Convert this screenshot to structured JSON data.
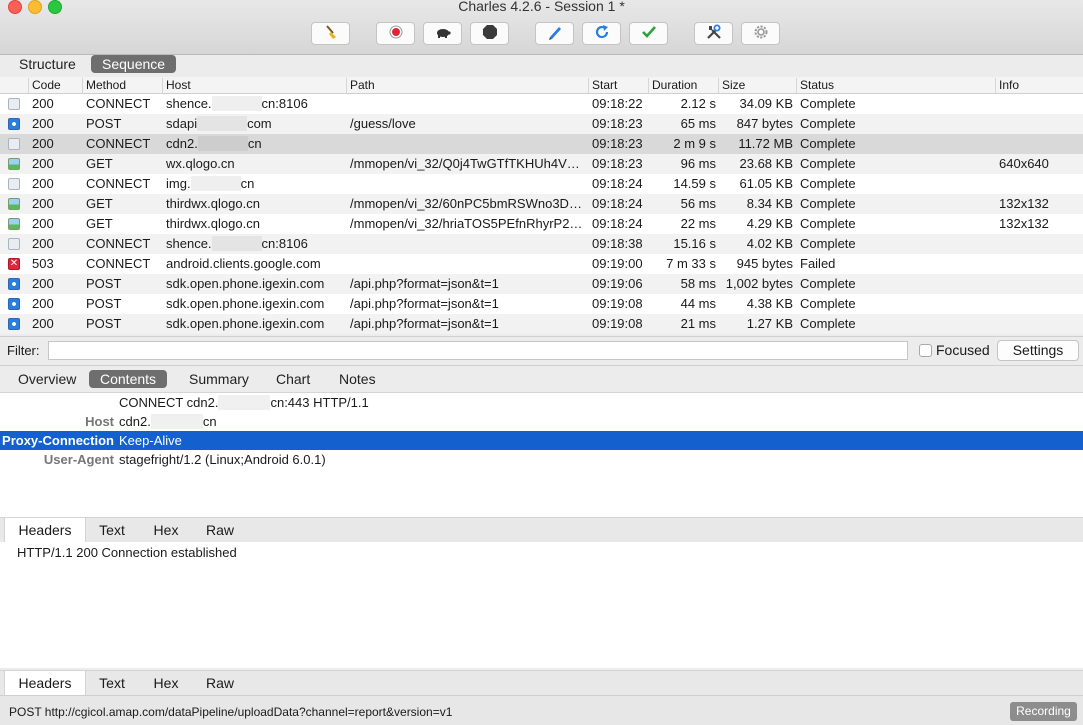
{
  "window": {
    "title": "Charles 4.2.6 - Session 1 *"
  },
  "toolbar": {
    "buttons": [
      "broom-icon",
      "record-icon",
      "turtle-icon",
      "stop-icon",
      "pen-icon",
      "refresh-icon",
      "check-icon",
      "tools-icon",
      "gear-icon"
    ]
  },
  "view_tabs": [
    "Structure",
    "Sequence"
  ],
  "table": {
    "columns": [
      "Code",
      "Method",
      "Host",
      "Path",
      "Start",
      "Duration",
      "Size",
      "Status",
      "Info"
    ],
    "rows": [
      {
        "icon": "doc",
        "code": "200",
        "method": "CONNECT",
        "host_a": "shence.",
        "host_b": "cn:8106",
        "path": "",
        "start": "09:18:22",
        "duration": "2.12 s",
        "size": "34.09 KB",
        "status": "Complete",
        "info": ""
      },
      {
        "icon": "blue",
        "code": "200",
        "method": "POST",
        "host_a": "sdapi",
        "host_b": "com",
        "path": "/guess/love",
        "start": "09:18:23",
        "duration": "65 ms",
        "size": "847 bytes",
        "status": "Complete",
        "info": ""
      },
      {
        "icon": "doc",
        "code": "200",
        "method": "CONNECT",
        "host_a": "cdn2.",
        "host_b": "cn",
        "path": "",
        "start": "09:18:23",
        "duration": "2 m 9 s",
        "size": "11.72 MB",
        "status": "Complete",
        "info": ""
      },
      {
        "icon": "image",
        "code": "200",
        "method": "GET",
        "host_a": "wx.qlogo.cn",
        "host_b": "",
        "path": "/mmopen/vi_32/Q0j4TwGTfTKHUh4V0...",
        "start": "09:18:23",
        "duration": "96 ms",
        "size": "23.68 KB",
        "status": "Complete",
        "info": "640x640"
      },
      {
        "icon": "doc",
        "code": "200",
        "method": "CONNECT",
        "host_a": "img.",
        "host_b": "cn",
        "path": "",
        "start": "09:18:24",
        "duration": "14.59 s",
        "size": "61.05 KB",
        "status": "Complete",
        "info": ""
      },
      {
        "icon": "image",
        "code": "200",
        "method": "GET",
        "host_a": "thirdwx.qlogo.cn",
        "host_b": "",
        "path": "/mmopen/vi_32/60nPC5bmRSWno3DX...",
        "start": "09:18:24",
        "duration": "56 ms",
        "size": "8.34 KB",
        "status": "Complete",
        "info": "132x132"
      },
      {
        "icon": "image",
        "code": "200",
        "method": "GET",
        "host_a": "thirdwx.qlogo.cn",
        "host_b": "",
        "path": "/mmopen/vi_32/hriaTOS5PEfnRhyrP29...",
        "start": "09:18:24",
        "duration": "22 ms",
        "size": "4.29 KB",
        "status": "Complete",
        "info": "132x132"
      },
      {
        "icon": "doc",
        "code": "200",
        "method": "CONNECT",
        "host_a": "shence.",
        "host_b": "cn:8106",
        "path": "",
        "start": "09:18:38",
        "duration": "15.16 s",
        "size": "4.02 KB",
        "status": "Complete",
        "info": ""
      },
      {
        "icon": "error",
        "code": "503",
        "method": "CONNECT",
        "host_a": "android.clients.google.com",
        "host_b": "",
        "path": "",
        "start": "09:19:00",
        "duration": "7 m 33 s",
        "size": "945 bytes",
        "status": "Failed",
        "info": ""
      },
      {
        "icon": "blue",
        "code": "200",
        "method": "POST",
        "host_a": "sdk.open.phone.igexin.com",
        "host_b": "",
        "path": "/api.php?format=json&t=1",
        "start": "09:19:06",
        "duration": "58 ms",
        "size": "1,002 bytes",
        "status": "Complete",
        "info": ""
      },
      {
        "icon": "blue",
        "code": "200",
        "method": "POST",
        "host_a": "sdk.open.phone.igexin.com",
        "host_b": "",
        "path": "/api.php?format=json&t=1",
        "start": "09:19:08",
        "duration": "44 ms",
        "size": "4.38 KB",
        "status": "Complete",
        "info": ""
      },
      {
        "icon": "blue",
        "code": "200",
        "method": "POST",
        "host_a": "sdk.open.phone.igexin.com",
        "host_b": "",
        "path": "/api.php?format=json&t=1",
        "start": "09:19:08",
        "duration": "21 ms",
        "size": "1.27 KB",
        "status": "Complete",
        "info": ""
      }
    ]
  },
  "filter": {
    "label": "Filter:",
    "value": "",
    "focused_label": "Focused",
    "settings_label": "Settings"
  },
  "detail_tabs": [
    "Overview",
    "Contents",
    "Summary",
    "Chart",
    "Notes"
  ],
  "request": {
    "first_line_a": "CONNECT cdn2.",
    "first_line_b": "cn:443 HTTP/1.1",
    "host_key": "Host",
    "host_a": "cdn2.",
    "host_b": "cn",
    "headers": [
      {
        "key": "Proxy-Connection",
        "value": "Keep-Alive"
      },
      {
        "key": "User-Agent",
        "value": "stagefright/1.2 (Linux;Android 6.0.1)"
      }
    ]
  },
  "sub_tabs": [
    "Headers",
    "Text",
    "Hex",
    "Raw"
  ],
  "response": {
    "first_line": "HTTP/1.1 200 Connection established"
  },
  "statusbar": {
    "text": "POST http://cgicol.amap.com/dataPipeline/uploadData?channel=report&version=v1",
    "recording": "Recording"
  },
  "colors": {
    "selection": "#1560cf",
    "record_red": "#e0243a",
    "accent_blue": "#2a7de1"
  }
}
